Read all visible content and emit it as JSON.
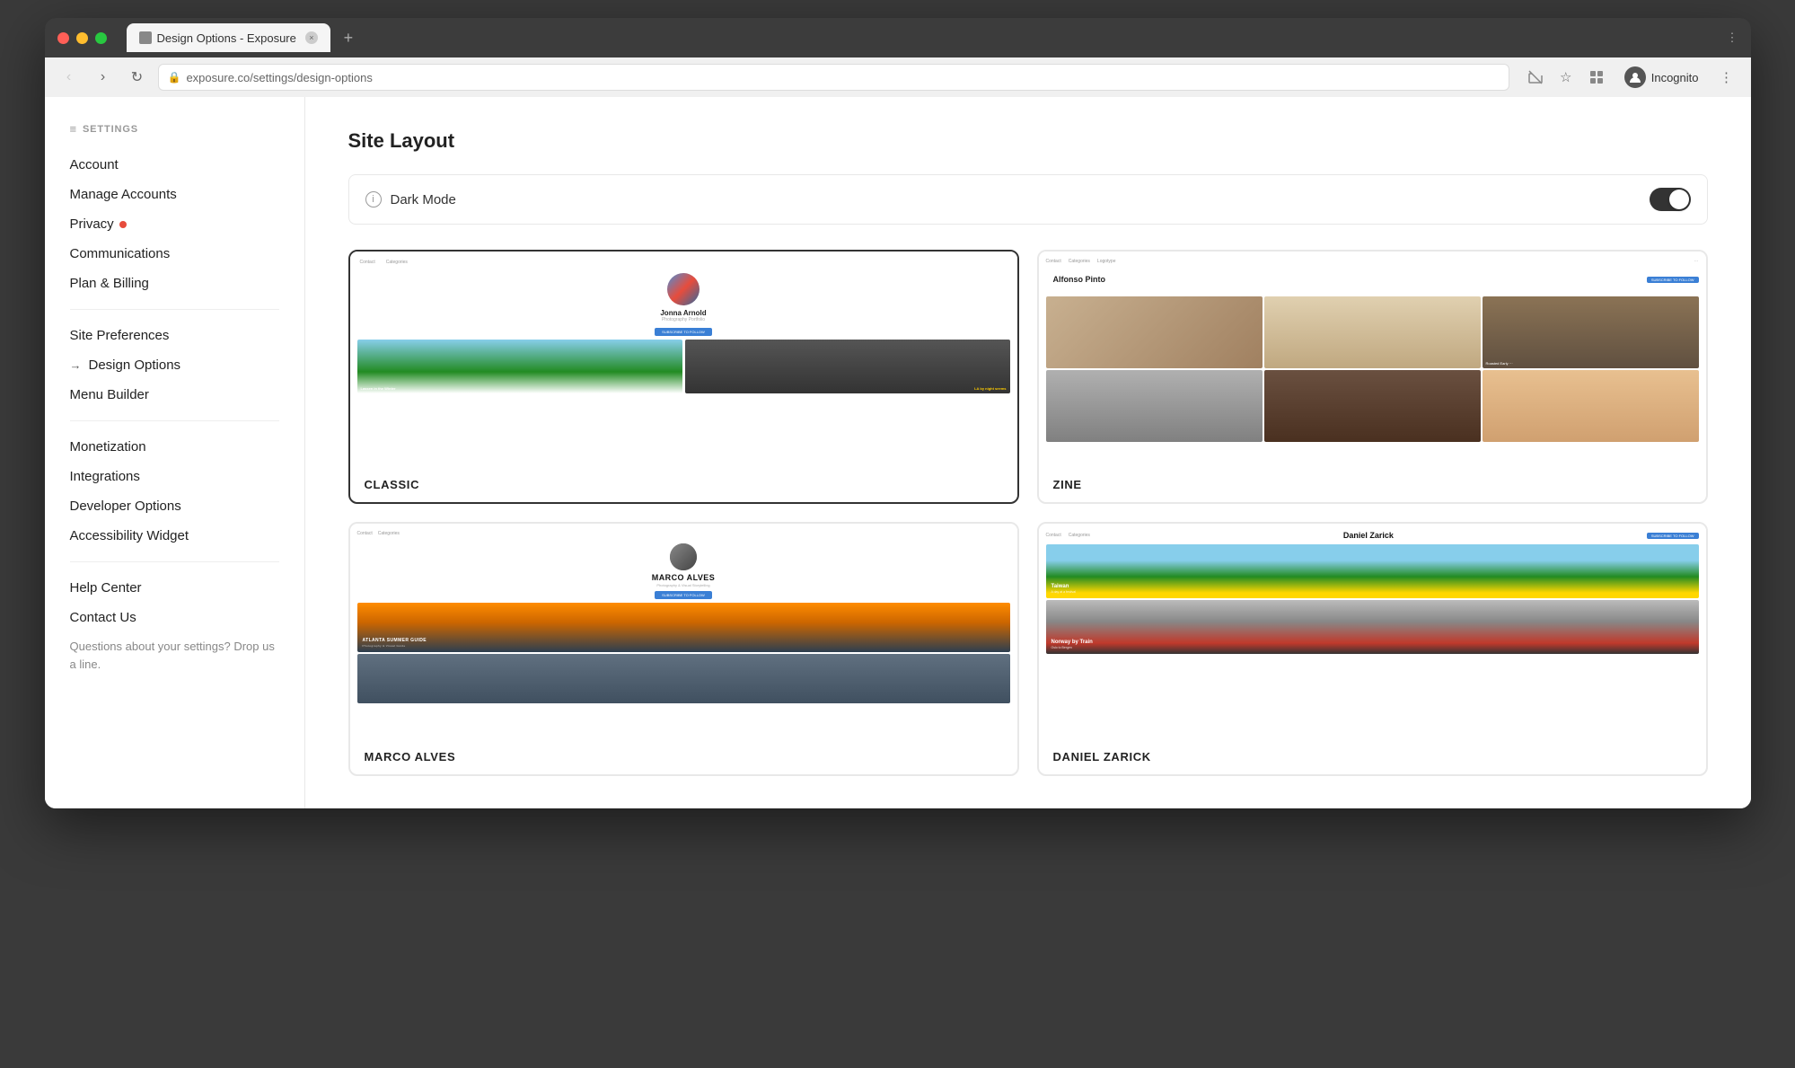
{
  "browser": {
    "tab_title": "Design Options - Exposure",
    "url": "exposure.co/settings/design-options",
    "new_tab_label": "+",
    "nav": {
      "back_label": "‹",
      "forward_label": "›",
      "refresh_label": "↻"
    },
    "toolbar_icons": [
      "camera-off",
      "star",
      "extensions",
      "profile"
    ],
    "incognito_label": "Incognito",
    "menu_label": "⋮"
  },
  "settings": {
    "section_label": "SETTINGS",
    "groups": [
      {
        "items": [
          {
            "id": "account",
            "label": "Account",
            "badge": false,
            "arrow": false
          },
          {
            "id": "manage-accounts",
            "label": "Manage Accounts",
            "badge": false,
            "arrow": false
          },
          {
            "id": "privacy",
            "label": "Privacy",
            "badge": true,
            "arrow": false
          },
          {
            "id": "communications",
            "label": "Communications",
            "badge": false,
            "arrow": false
          },
          {
            "id": "plan-billing",
            "label": "Plan & Billing",
            "badge": false,
            "arrow": false
          }
        ]
      },
      {
        "items": [
          {
            "id": "site-preferences",
            "label": "Site Preferences",
            "badge": false,
            "arrow": false
          },
          {
            "id": "design-options",
            "label": "Design Options",
            "badge": false,
            "arrow": true
          },
          {
            "id": "menu-builder",
            "label": "Menu Builder",
            "badge": false,
            "arrow": false
          }
        ]
      },
      {
        "items": [
          {
            "id": "monetization",
            "label": "Monetization",
            "badge": false,
            "arrow": false
          },
          {
            "id": "integrations",
            "label": "Integrations",
            "badge": false,
            "arrow": false
          },
          {
            "id": "developer-options",
            "label": "Developer Options",
            "badge": false,
            "arrow": false
          },
          {
            "id": "accessibility-widget",
            "label": "Accessibility Widget",
            "badge": false,
            "arrow": false
          }
        ]
      },
      {
        "items": [
          {
            "id": "help-center",
            "label": "Help Center",
            "badge": false,
            "arrow": false
          },
          {
            "id": "contact-us",
            "label": "Contact Us",
            "badge": false,
            "arrow": false
          }
        ]
      }
    ],
    "contact_text": "Questions about your settings? Drop us a line."
  },
  "main": {
    "page_title": "Site Layout",
    "dark_mode": {
      "label": "Dark Mode",
      "enabled": true
    },
    "layouts": [
      {
        "id": "classic",
        "label": "CLASSIC",
        "selected": true,
        "preview": {
          "user_name": "Jonna Arnold",
          "photo1_caption": "Lassen in the Winter",
          "photo2_caption": "LA by night seems"
        }
      },
      {
        "id": "zine",
        "label": "ZINE",
        "selected": false,
        "preview": {
          "site_name": "Alfonso Pinto",
          "nav_items": [
            "Contact",
            "Categories",
            "Logotype"
          ]
        }
      },
      {
        "id": "marco",
        "label": "MARCO ALVES",
        "selected": false,
        "preview": {
          "user_name": "MARCO ALVES",
          "photo_caption": "ATLANTA SUMMER GUIDE"
        }
      },
      {
        "id": "daniel",
        "label": "DANIEL ZARICK",
        "selected": false,
        "preview": {
          "user_name": "Daniel Zarick",
          "photo1_caption": "Taiwan",
          "photo1_sub": "A day at a festival",
          "photo2_caption": "Norway by Train",
          "photo2_sub": "Oslo to Bergen"
        }
      }
    ]
  }
}
